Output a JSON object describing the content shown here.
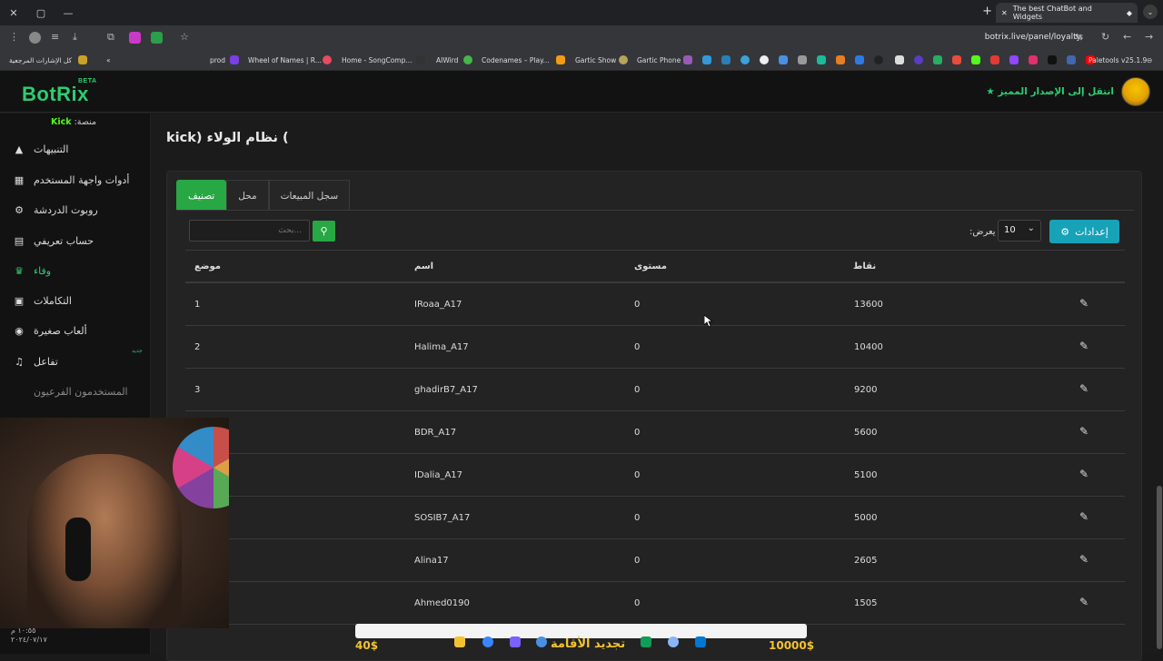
{
  "browser": {
    "tab_title": "The best ChatBot and Widgets",
    "url": "botrix.live/panel/loyalty",
    "extension_label": "Paletools v25.1.9",
    "bookmarks": [
      "كل الإشارات المرجعية",
      "prod",
      "Wheel of Names | R...",
      "Home - SongComp...",
      "AIWird",
      "Codenames – Play...",
      "Gartic Show",
      "Gartic Phone"
    ]
  },
  "app": {
    "logo": "BotRix",
    "logo_badge": "BETA",
    "premium_link": "انتقل إلى الإصدار المميز",
    "platform_label": "منصة:",
    "platform_name": "Kick"
  },
  "sidebar": {
    "items": [
      {
        "label": "التنبيهات",
        "icon": "warning-icon"
      },
      {
        "label": "أدوات واجهة المستخدم",
        "icon": "table-icon"
      },
      {
        "label": "روبوت الدردشة",
        "icon": "robot-icon"
      },
      {
        "label": "حساب تعريفي",
        "icon": "id-card-icon"
      },
      {
        "label": "وفاء",
        "icon": "trophy-icon",
        "active": true
      },
      {
        "label": "التكاملات",
        "icon": "integration-icon"
      },
      {
        "label": "ألعاب صغيرة",
        "icon": "gamepad-icon"
      },
      {
        "label": "تفاعل",
        "icon": "music-icon",
        "badge": "جديد"
      },
      {
        "label": "المستخدمون الفرعيون",
        "icon": "users-icon",
        "muted": true
      }
    ]
  },
  "main": {
    "title": "kick) نظام الولاء (",
    "tabs": [
      {
        "label": "تصنيف",
        "active": true
      },
      {
        "label": "محل"
      },
      {
        "label": "سجل المبيعات"
      }
    ],
    "search_placeholder": "...بحث",
    "show_label": "يعرض:",
    "page_size": "10",
    "settings_label": "إعدادات",
    "columns": {
      "position": "موضع",
      "name": "اسم",
      "level": "مستوى",
      "points": "نقاط"
    },
    "rows": [
      {
        "position": "1",
        "name": "IRoaa_A17",
        "level": "0",
        "points": "13600"
      },
      {
        "position": "2",
        "name": "Halima_A17",
        "level": "0",
        "points": "10400"
      },
      {
        "position": "3",
        "name": "ghadirB7_A17",
        "level": "0",
        "points": "9200"
      },
      {
        "position": "",
        "name": "BDR_A17",
        "level": "0",
        "points": "5600"
      },
      {
        "position": "",
        "name": "IDalia_A17",
        "level": "0",
        "points": "5100"
      },
      {
        "position": "",
        "name": "SOSIB7_A17",
        "level": "0",
        "points": "5000"
      },
      {
        "position": "",
        "name": "Alina17",
        "level": "0",
        "points": "2605"
      },
      {
        "position": "",
        "name": "Ahmed0190",
        "level": "0",
        "points": "1505"
      }
    ]
  },
  "overlay": {
    "left_amount": "40$",
    "center_text": "تجديد الأقامة",
    "right_amount": "10000$",
    "clock_time": "١٠:٥٥ م",
    "clock_date": "٢٠٢٤/٠٧/١٧"
  },
  "colors": {
    "accent_green": "#2ecc71",
    "tab_active": "#28a745",
    "settings_button": "#17a2b8",
    "kick_green": "#53fc18"
  }
}
